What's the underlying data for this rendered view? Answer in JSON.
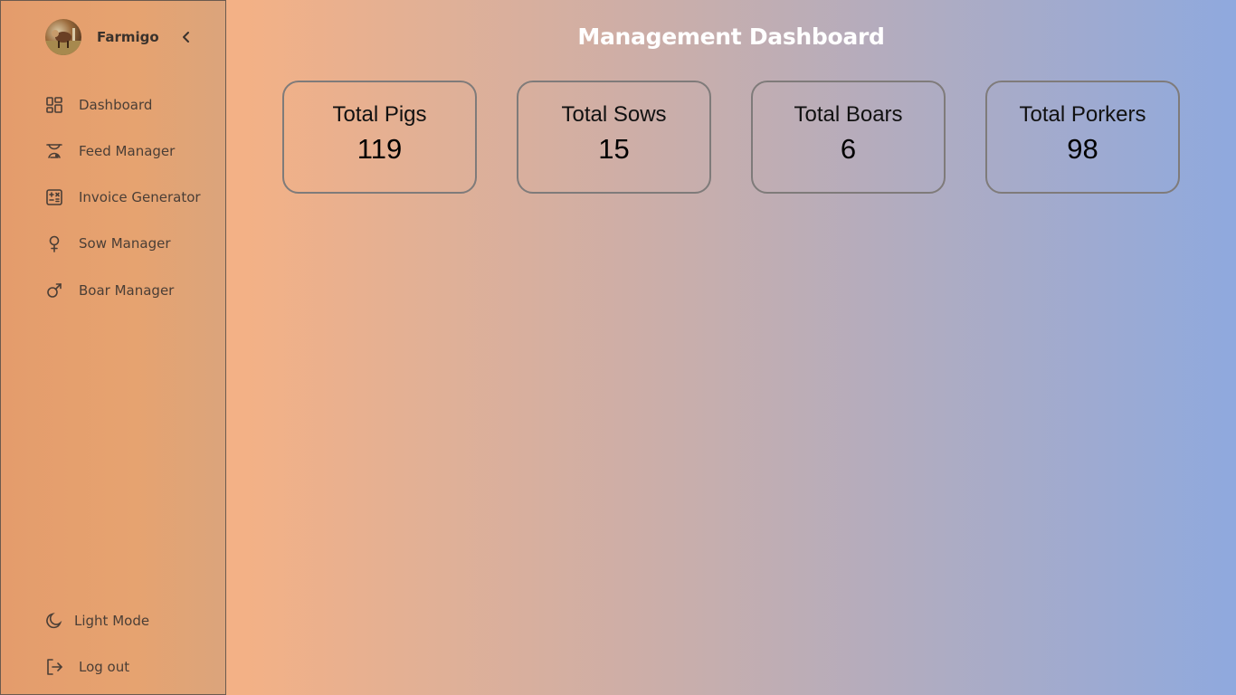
{
  "app": {
    "name": "Farmigo"
  },
  "sidebar": {
    "items": [
      {
        "label": "Dashboard",
        "icon": "dashboard-icon"
      },
      {
        "label": "Feed Manager",
        "icon": "feed-icon"
      },
      {
        "label": "Invoice Generator",
        "icon": "calculator-icon"
      },
      {
        "label": "Sow Manager",
        "icon": "female-icon"
      },
      {
        "label": "Boar Manager",
        "icon": "male-icon"
      }
    ],
    "footer": [
      {
        "label": "Light Mode",
        "icon": "moon-icon"
      },
      {
        "label": "Log out",
        "icon": "logout-icon"
      }
    ]
  },
  "main": {
    "title": "Management Dashboard",
    "cards": [
      {
        "label": "Total Pigs",
        "value": "119"
      },
      {
        "label": "Total Sows",
        "value": "15"
      },
      {
        "label": "Total Boars",
        "value": "6"
      },
      {
        "label": "Total Porkers",
        "value": "98"
      }
    ]
  },
  "colors": {
    "sidebar": "#e49c6c",
    "gradient_start": "#f0b088",
    "gradient_end": "#8fa9de",
    "title": "#ffffff"
  }
}
